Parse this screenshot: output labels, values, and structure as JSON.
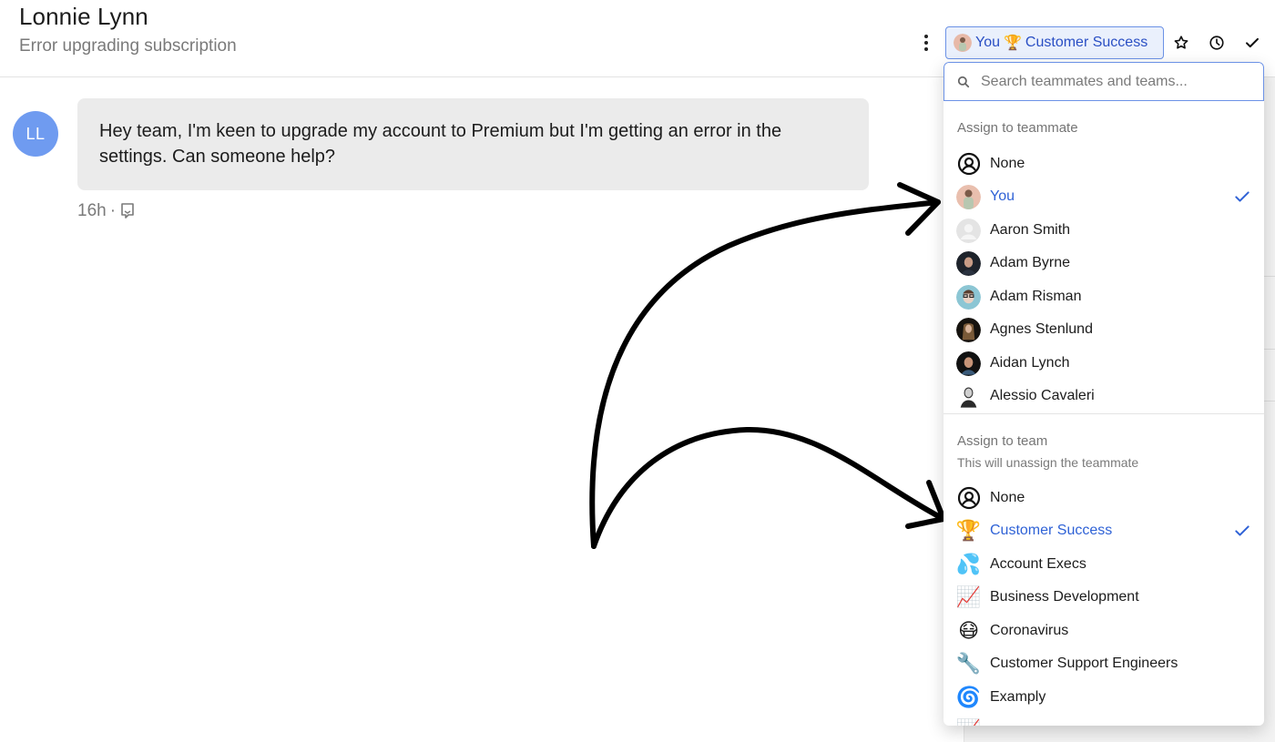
{
  "header": {
    "title": "Lonnie Lynn",
    "subtitle": "Error upgrading subscription",
    "assignee_button": {
      "teammate_label": "You",
      "team_emoji": "🏆",
      "team_label": "Customer Success"
    },
    "icons": [
      "more-vertical-icon",
      "star-icon",
      "clock-icon",
      "check-icon"
    ]
  },
  "conversation": {
    "avatar_initials": "LL",
    "avatar_color": "#6f9bf0",
    "message": "Hey team, I'm keen to upgrade my account to Premium but I'm getting an error in the settings. Can someone help?",
    "time": "16h",
    "separator": "·"
  },
  "dropdown": {
    "search_placeholder": "Search teammates and teams...",
    "teammates_title": "Assign to teammate",
    "teammates": [
      {
        "name": "None",
        "icon": "person-outline",
        "selected": false
      },
      {
        "name": "You",
        "icon": "avatar",
        "selected": true
      },
      {
        "name": "Aaron Smith",
        "icon": "avatar-placeholder",
        "selected": false
      },
      {
        "name": "Adam Byrne",
        "icon": "avatar",
        "selected": false
      },
      {
        "name": "Adam Risman",
        "icon": "avatar",
        "selected": false
      },
      {
        "name": "Agnes Stenlund",
        "icon": "avatar",
        "selected": false
      },
      {
        "name": "Aidan Lynch",
        "icon": "avatar",
        "selected": false
      },
      {
        "name": "Alessio Cavaleri",
        "icon": "avatar",
        "selected": false
      }
    ],
    "teams_title": "Assign to team",
    "teams_subtitle": "This will unassign the teammate",
    "teams": [
      {
        "name": "None",
        "emoji": "",
        "selected": false
      },
      {
        "name": "Customer Success",
        "emoji": "🏆",
        "selected": true
      },
      {
        "name": "Account Execs",
        "emoji": "💦",
        "selected": false
      },
      {
        "name": "Business Development",
        "emoji": "📈",
        "selected": false
      },
      {
        "name": "Coronavirus",
        "emoji": "😷",
        "selected": false
      },
      {
        "name": "Customer Support Engineers",
        "emoji": "🔧",
        "selected": false
      },
      {
        "name": "Examply",
        "emoji": "🌀",
        "selected": false
      },
      {
        "name": "",
        "emoji": "📈",
        "selected": false
      }
    ]
  },
  "colors": {
    "accent": "#2f62d6",
    "accent_border": "#6c92e6",
    "accent_bg": "#eaf0fc",
    "bubble_bg": "#ebebeb"
  }
}
